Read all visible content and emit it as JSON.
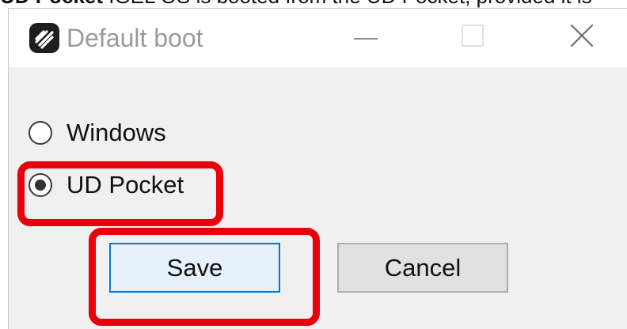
{
  "document": {
    "caption_bold": "UD Pocket",
    "caption_rest": " IGEL OS is booted from the UD Pocket, provided it is"
  },
  "dialog": {
    "title": "Default boot",
    "app_icon": "igel-logo-icon",
    "controls": {
      "minimize_icon": "minimize-icon",
      "maximize_icon": "maximize-icon",
      "close_icon": "close-icon"
    },
    "options": [
      {
        "label": "Windows",
        "selected": false
      },
      {
        "label": "UD Pocket",
        "selected": true
      }
    ],
    "buttons": {
      "save_label": "Save",
      "cancel_label": "Cancel"
    }
  },
  "colors": {
    "highlight": "#e8000b",
    "default_button_border": "#0078d7",
    "default_button_fill": "#e5f1fb",
    "dialog_background": "#f0f0f0"
  }
}
